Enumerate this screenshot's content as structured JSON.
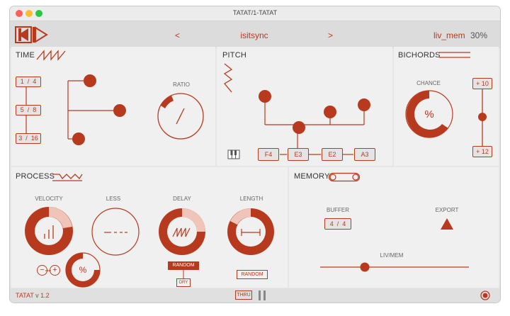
{
  "window": {
    "title": "TATAT/1-TATAT"
  },
  "header": {
    "prev": "<",
    "preset_name": "isitsync",
    "next": ">",
    "mode": "liv_mem",
    "percent": "30%"
  },
  "time": {
    "title": "TIME",
    "ratios": [
      {
        "num": "1",
        "den": "4"
      },
      {
        "num": "5",
        "den": "8"
      },
      {
        "num": "3",
        "den": "16"
      }
    ],
    "ratio_label": "RATIO"
  },
  "pitch": {
    "title": "PITCH",
    "notes": [
      "F4",
      "E3",
      "E2",
      "A3"
    ]
  },
  "bichords": {
    "title": "BICHORDS",
    "chance_label": "CHANCE",
    "chance_symbol": "%",
    "plus_top": "+ 10",
    "plus_bottom": "+ 12"
  },
  "process": {
    "title": "PROCESS",
    "velocity_label": "VELOCITY",
    "less_label": "LESS",
    "delay_label": "DELAY",
    "length_label": "LENGTH",
    "percent_symbol": "%",
    "minus": "−",
    "plus": "+",
    "delay_random": "RANDOM",
    "delay_dry": "DRY",
    "length_random": "RANDOM"
  },
  "memory": {
    "title": "MEMORY",
    "buffer_label": "BUFFER",
    "buffer_num": "4",
    "buffer_den": "4",
    "export_label": "EXPORT",
    "livmem_label": "LIV/MEM"
  },
  "footer": {
    "version": "TATAT v 1.2",
    "thru": "THRU"
  },
  "colors": {
    "accent": "#b83a1e",
    "panel": "#f0f0f0",
    "background": "#e6e6e6"
  }
}
